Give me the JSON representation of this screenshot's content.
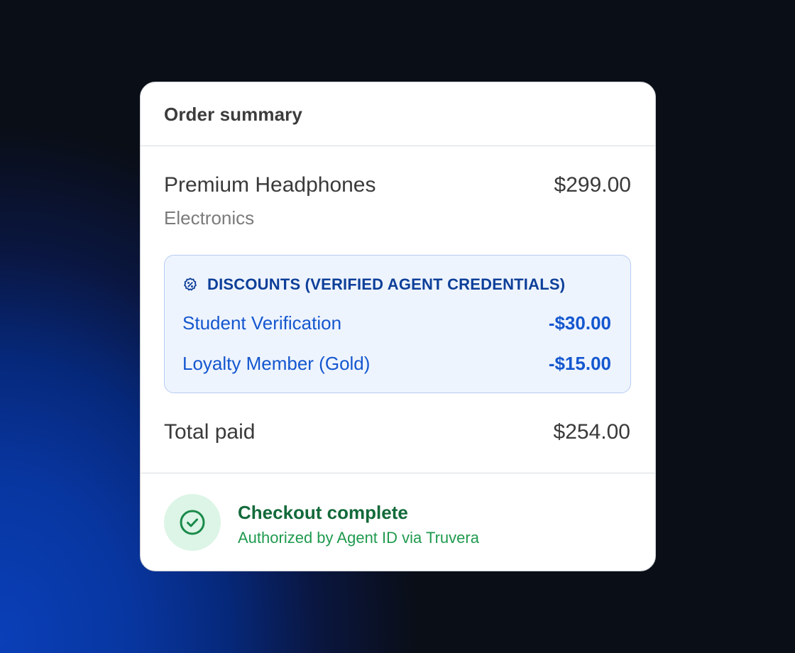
{
  "card": {
    "title": "Order summary"
  },
  "product": {
    "name": "Premium Headphones",
    "price": "$299.00",
    "category": "Electronics"
  },
  "discounts": {
    "icon": "discount-badge-icon",
    "title": "DISCOUNTS (VERIFIED AGENT CREDENTIALS)",
    "items": [
      {
        "label": "Student Verification",
        "amount": "-$30.00"
      },
      {
        "label": "Loyalty Member (Gold)",
        "amount": "-$15.00"
      }
    ]
  },
  "total": {
    "label": "Total paid",
    "value": "$254.00"
  },
  "status": {
    "icon": "check-circle-icon",
    "title": "Checkout complete",
    "subtitle": "Authorized by Agent ID via Truvera"
  },
  "colors": {
    "accent_blue": "#1457cf",
    "discount_bg": "#eef4fe",
    "success_green": "#136a3a",
    "success_bg": "#dcf5e6"
  }
}
